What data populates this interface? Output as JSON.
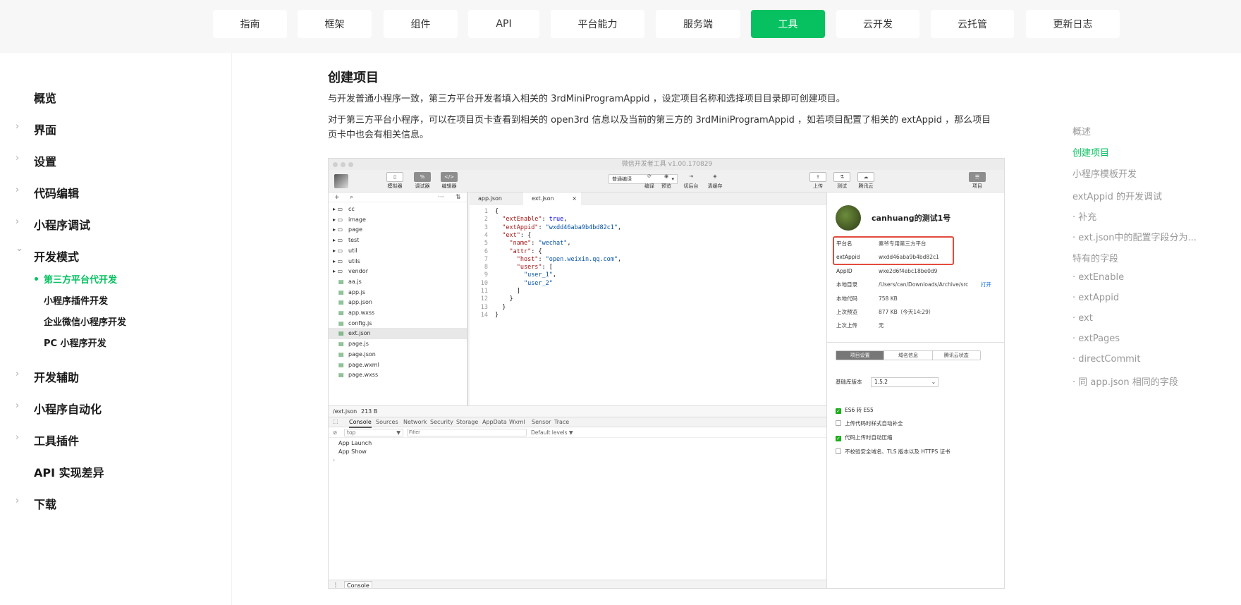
{
  "topnav": {
    "items": [
      {
        "label": "指南",
        "active": false
      },
      {
        "label": "框架",
        "active": false
      },
      {
        "label": "组件",
        "active": false
      },
      {
        "label": "API",
        "active": false
      },
      {
        "label": "平台能力",
        "active": false
      },
      {
        "label": "服务端",
        "active": false
      },
      {
        "label": "工具",
        "active": true
      },
      {
        "label": "云开发",
        "active": false
      },
      {
        "label": "云托管",
        "active": false
      },
      {
        "label": "更新日志",
        "active": false
      }
    ]
  },
  "sidebar": {
    "items": [
      {
        "label": "概览",
        "arrow": ""
      },
      {
        "label": "界面",
        "arrow": "›"
      },
      {
        "label": "设置",
        "arrow": "›"
      },
      {
        "label": "代码编辑",
        "arrow": "›"
      },
      {
        "label": "小程序调试",
        "arrow": "›"
      },
      {
        "label": "开发模式",
        "arrow": "⌄"
      },
      {
        "label": "开发辅助",
        "arrow": "›"
      },
      {
        "label": "小程序自动化",
        "arrow": "›"
      },
      {
        "label": "工具插件",
        "arrow": "›"
      },
      {
        "label": "API 实现差异",
        "arrow": ""
      },
      {
        "label": "下载",
        "arrow": "›"
      }
    ],
    "sub_items": [
      {
        "label": "第三方平台代开发",
        "active": true
      },
      {
        "label": "小程序插件开发",
        "active": false
      },
      {
        "label": "企业微信小程序开发",
        "active": false
      },
      {
        "label": "PC 小程序开发",
        "active": false
      }
    ]
  },
  "main": {
    "title": "创建项目",
    "para1": "与开发普通小程序一致，第三方平台开发者填入相关的 3rdMiniProgramAppid ，设定项目名称和选择项目目录即可创建项目。",
    "para2": "对于第三方平台小程序，可以在项目页卡查看到相关的 open3rd 信息以及当前的第三方的 3rdMiniProgramAppid ，如若项目配置了相关的 extAppid ，那么项目页卡中也会有相关信息。"
  },
  "toc": {
    "items": [
      {
        "label": "概述",
        "active": false
      },
      {
        "label": "创建项目",
        "active": true
      },
      {
        "label": "小程序模板开发",
        "active": false
      },
      {
        "label": "extAppid 的开发调试",
        "active": false
      },
      {
        "label": "· 补充",
        "active": false
      },
      {
        "label": "· ext.json中的配置字段分为...",
        "active": false
      },
      {
        "label": "特有的字段",
        "active": false
      },
      {
        "label": "· extEnable",
        "active": false
      },
      {
        "label": "· extAppid",
        "active": false
      },
      {
        "label": "· ext",
        "active": false
      },
      {
        "label": "· extPages",
        "active": false
      },
      {
        "label": "· directCommit",
        "active": false
      },
      {
        "label": "· 同 app.json 相同的字段",
        "active": false
      }
    ]
  },
  "shot": {
    "window_title": "微信开发者工具 v1.00.170829",
    "toolbar": {
      "simulator": "模拟器",
      "debugger": "调试器",
      "editor": "编辑器",
      "compile_mode": "普通编译",
      "compile": "编译",
      "preview": "预览",
      "background": "切后台",
      "clear_cache": "清缓存",
      "upload": "上传",
      "test": "测试",
      "tencent_cloud": "腾讯云",
      "project": "项目"
    },
    "tree": [
      {
        "name": "cc",
        "type": "folder"
      },
      {
        "name": "image",
        "type": "folder"
      },
      {
        "name": "page",
        "type": "folder"
      },
      {
        "name": "test",
        "type": "folder"
      },
      {
        "name": "util",
        "type": "folder"
      },
      {
        "name": "utils",
        "type": "folder"
      },
      {
        "name": "vendor",
        "type": "folder"
      },
      {
        "name": "aa.js",
        "type": "file"
      },
      {
        "name": "app.js",
        "type": "file"
      },
      {
        "name": "app.json",
        "type": "file"
      },
      {
        "name": "app.wxss",
        "type": "file"
      },
      {
        "name": "config.js",
        "type": "file"
      },
      {
        "name": "ext.json",
        "type": "file",
        "selected": true
      },
      {
        "name": "page.js",
        "type": "file"
      },
      {
        "name": "page.json",
        "type": "file"
      },
      {
        "name": "page.wxml",
        "type": "file"
      },
      {
        "name": "page.wxss",
        "type": "file"
      }
    ],
    "editor_tabs": [
      "app.json",
      "ext.json"
    ],
    "code": [
      "{",
      "  \"extEnable\": true,",
      "  \"extAppid\": \"wxdd46aba9b4bd82c1\",",
      "  \"ext\": {",
      "    \"name\": \"wechat\",",
      "    \"attr\": {",
      "      \"host\": \"open.weixin.qq.com\",",
      "      \"users\": [",
      "        \"user_1\",",
      "        \"user_2\"",
      "      ]",
      "    }",
      "  }",
      "}"
    ],
    "status": {
      "path": "/ext.json",
      "size": "213 B"
    },
    "dev_tabs": [
      "Console",
      "Sources",
      "Network",
      "Security",
      "Storage",
      "AppData",
      "Wxml",
      "Sensor",
      "Trace"
    ],
    "filter": {
      "context": "top",
      "placeholder": "Filter",
      "levels": "Default levels ▼"
    },
    "console_lines": [
      "App  Launch",
      "App  Show",
      "›"
    ],
    "bottom_tab": "Console",
    "panel": {
      "project_name": "canhuang的测试1号",
      "rows": [
        {
          "label": "平台名",
          "value": "秦爷专用第三方平台"
        },
        {
          "label": "extAppid",
          "value": "wxdd46aba9b4bd82c1"
        },
        {
          "label": "AppID",
          "value": "wxe2d6f4ebc18be0d9"
        },
        {
          "label": "本地目录",
          "value": "/Users/can/Downloads/Archive/src",
          "action": "打开"
        },
        {
          "label": "本地代码",
          "value": "758 KB"
        },
        {
          "label": "上次预览",
          "value": "877 KB（今天14:29）"
        },
        {
          "label": "上次上传",
          "value": "无"
        }
      ],
      "tabs": [
        {
          "label": "项目设置",
          "active": true
        },
        {
          "label": "域名信息",
          "active": false
        },
        {
          "label": "腾讯云状态",
          "active": false
        }
      ],
      "lib_label": "基础库版本",
      "lib_value": "1.5.2",
      "checks": [
        {
          "label": "ES6 转 ES5",
          "checked": true
        },
        {
          "label": "上传代码时样式自动补全",
          "checked": false
        },
        {
          "label": "代码上传时自动压缩",
          "checked": true
        },
        {
          "label": "不校验安全域名、TLS 版本以及 HTTPS 证书",
          "checked": false
        }
      ]
    }
  }
}
